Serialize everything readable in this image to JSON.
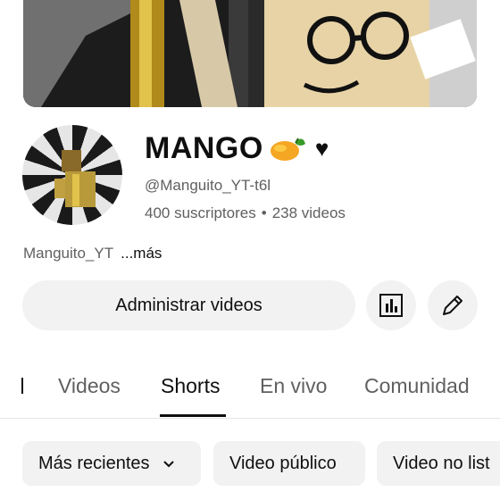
{
  "channel": {
    "name": "MANGO",
    "heart": "♥",
    "handle": "@Manguito_YT-t6l",
    "subscribers": "400 suscriptores",
    "separator": "•",
    "videos": "238 videos",
    "description": "Manguito_YT",
    "more": "...más"
  },
  "actions": {
    "manage_label": "Administrar videos"
  },
  "tabs": [
    {
      "label": "Videos"
    },
    {
      "label": "Shorts"
    },
    {
      "label": "En vivo"
    },
    {
      "label": "Comunidad"
    }
  ],
  "active_tab": "Shorts",
  "filters": [
    {
      "label": "Más recientes"
    },
    {
      "label": "Video público"
    },
    {
      "label": "Video no list"
    }
  ],
  "icons": {
    "mango": "mango-emoji",
    "stats": "analytics-icon",
    "edit": "pencil-icon",
    "dropdown": "chevron-down-icon"
  }
}
